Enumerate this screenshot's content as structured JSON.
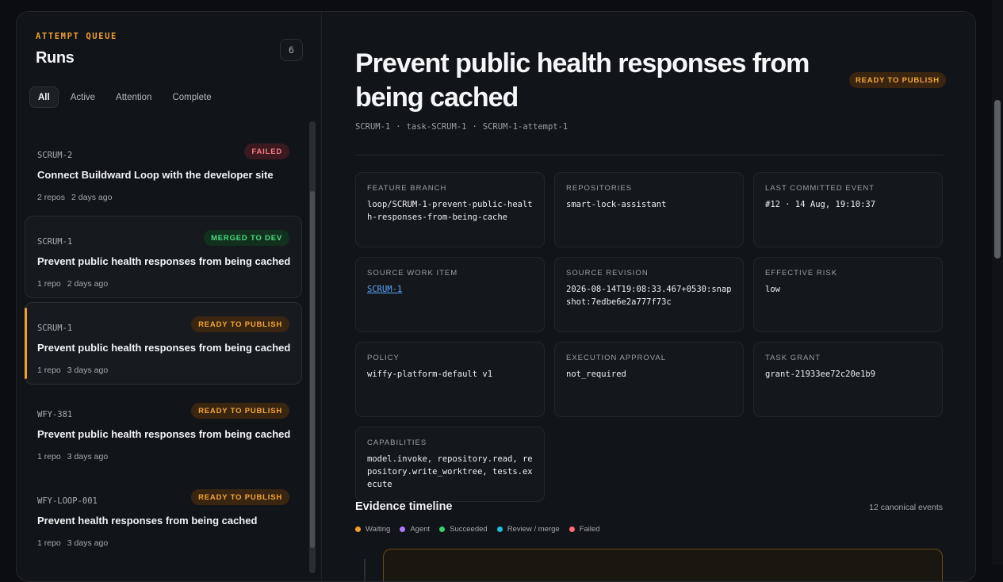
{
  "sidebar": {
    "kicker": "ATTEMPT QUEUE",
    "title": "Runs",
    "count": "6",
    "filters": [
      {
        "label": "All",
        "active": true
      },
      {
        "label": "Active",
        "active": false
      },
      {
        "label": "Attention",
        "active": false
      },
      {
        "label": "Complete",
        "active": false
      }
    ],
    "runs": [
      {
        "id": "SCRUM-2",
        "badge": "FAILED",
        "status": "failed",
        "title": "Connect Buildward Loop with the developer site",
        "repos": "2 repos",
        "age": "2 days ago"
      },
      {
        "id": "SCRUM-1",
        "badge": "MERGED TO DEV",
        "status": "merged",
        "title": "Prevent public health responses from being cached",
        "repos": "1 repo",
        "age": "2 days ago"
      },
      {
        "id": "SCRUM-1",
        "badge": "READY TO PUBLISH",
        "status": "ready",
        "title": "Prevent public health responses from being cached",
        "repos": "1 repo",
        "age": "3 days ago"
      },
      {
        "id": "WFY-381",
        "badge": "READY TO PUBLISH",
        "status": "ready",
        "title": "Prevent public health responses from being cached",
        "repos": "1 repo",
        "age": "3 days ago"
      },
      {
        "id": "WFY-LOOP-001",
        "badge": "READY TO PUBLISH",
        "status": "ready",
        "title": "Prevent health responses from being cached",
        "repos": "1 repo",
        "age": "3 days ago"
      }
    ]
  },
  "detail": {
    "title": "Prevent public health responses from being cached",
    "status_badge": "READY TO PUBLISH",
    "breadcrumb": [
      "SCRUM-1",
      "·",
      "task-SCRUM-1",
      "·",
      "SCRUM-1-attempt-1"
    ],
    "fields": [
      {
        "label": "FEATURE BRANCH",
        "value": "loop/SCRUM-1-prevent-public-health-responses-from-being-cache",
        "link": false
      },
      {
        "label": "REPOSITORIES",
        "value": "smart-lock-assistant",
        "link": false
      },
      {
        "label": "LAST COMMITTED EVENT",
        "value": "#12 · 14 Aug, 19:10:37",
        "link": false
      },
      {
        "label": "SOURCE WORK ITEM",
        "value": "SCRUM-1",
        "link": true
      },
      {
        "label": "SOURCE REVISION",
        "value": "2026-08-14T19:08:33.467+0530:snapshot:7edbe6e2a777f73c",
        "link": false
      },
      {
        "label": "EFFECTIVE RISK",
        "value": "low",
        "link": false
      },
      {
        "label": "POLICY",
        "value": "wiffy-platform-default v1",
        "link": false
      },
      {
        "label": "EXECUTION APPROVAL",
        "value": "not_required",
        "link": false
      },
      {
        "label": "TASK GRANT",
        "value": "grant-21933ee72c20e1b9",
        "link": false
      },
      {
        "label": "CAPABILITIES",
        "value": "model.invoke, repository.read, repository.write_worktree, tests.execute",
        "link": false
      }
    ],
    "timeline": {
      "title": "Evidence timeline",
      "count": "12 canonical events",
      "legend": [
        {
          "label": "Waiting",
          "color": "#f0a030"
        },
        {
          "label": "Agent",
          "color": "#b07cff"
        },
        {
          "label": "Succeeded",
          "color": "#3ccf72"
        },
        {
          "label": "Review / merge",
          "color": "#22b8e0"
        },
        {
          "label": "Failed",
          "color": "#ff6b7a"
        }
      ]
    }
  },
  "colors": {
    "accent": "#f0a030",
    "failed": "#ff7a86",
    "merged": "#4ade80",
    "link": "#5aa4ff"
  }
}
